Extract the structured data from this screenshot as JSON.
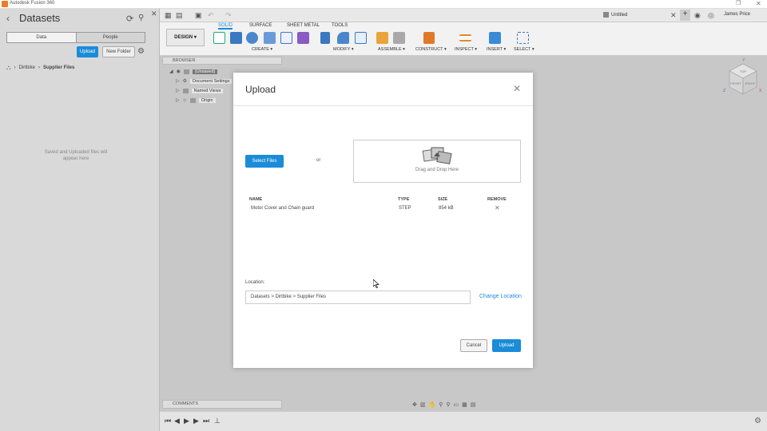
{
  "window": {
    "title": "Autodesk Fusion 360"
  },
  "data_panel": {
    "title": "Datasets",
    "tabs": [
      {
        "label": "Data"
      },
      {
        "label": "People"
      }
    ],
    "upload_label": "Upload",
    "new_folder_label": "New Folder",
    "breadcrumb": [
      "Dirtbike",
      "Supplier Files"
    ],
    "empty_message": "Saved and Uploaded files will appear here"
  },
  "quickbar": {
    "document_title": "Untitled",
    "user_name": "James Price"
  },
  "toolbar": {
    "workspace": "DESIGN",
    "tabs": [
      "SOLID",
      "SURFACE",
      "SHEET METAL",
      "TOOLS"
    ],
    "groups": [
      "CREATE",
      "MODIFY",
      "ASSEMBLE",
      "CONSTRUCT",
      "INSPECT",
      "INSERT",
      "SELECT"
    ]
  },
  "browser": {
    "label": "BROWSER",
    "items": [
      "(Unsaved)",
      "Document Settings",
      "Named Views",
      "Origin"
    ]
  },
  "viewcube": {
    "top": "TOP",
    "front": "FRONT",
    "right": "RIGHT",
    "axis_y": "Y",
    "axis_z": "Z",
    "axis_x": "X"
  },
  "comments": {
    "label": "COMMENTS"
  },
  "upload_dialog": {
    "title": "Upload",
    "select_files_label": "Select Files",
    "or_text": "or",
    "drop_text": "Drag and Drop Here",
    "columns": {
      "name": "NAME",
      "type": "TYPE",
      "size": "SIZE",
      "remove": "REMOVE"
    },
    "files": [
      {
        "name": "Motor Cover and Chain guard",
        "type": "STEP",
        "size": "854 kB"
      }
    ],
    "location_label": "Location:",
    "location_path": "Datasets > Dirtbike > Supplier Files",
    "change_location_label": "Change Location",
    "cancel_label": "Cancel",
    "upload_label": "Upload"
  },
  "colors": {
    "accent": "#1a8cd8",
    "brand": "#f07a22"
  }
}
